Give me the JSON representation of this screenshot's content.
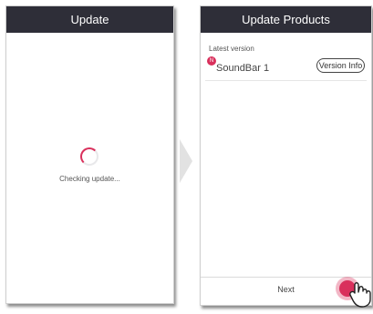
{
  "left_screen": {
    "title": "Update",
    "status": "Checking update..."
  },
  "right_screen": {
    "title": "Update Products",
    "section_label": "Latest version",
    "badge": "N",
    "device": "SoundBar 1",
    "version_button": "Version Info",
    "next_button": "Next"
  },
  "colors": {
    "titlebar": "#2e2e38",
    "accent": "#d9305c"
  }
}
